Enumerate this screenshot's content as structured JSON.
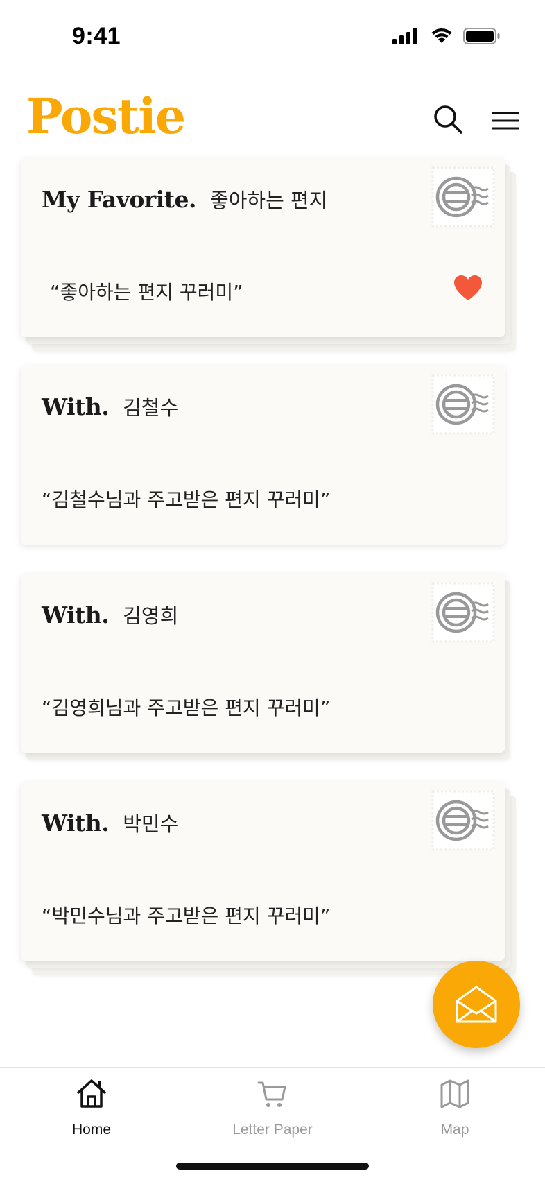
{
  "status_bar": {
    "time": "9:41",
    "icons": [
      "signal-icon",
      "wifi-icon",
      "battery-icon"
    ]
  },
  "header": {
    "logo": "Postie",
    "logo_color": "#F9A806",
    "icons": [
      "search-icon",
      "hamburger-menu-icon"
    ]
  },
  "cards": [
    {
      "kind": "My Favorite.",
      "name": "좋아하는 편지",
      "quote": "“좋아하는 편지 꾸러미”",
      "favorite": true
    },
    {
      "kind": "With.",
      "name": "김철수",
      "quote": "“김철수님과 주고받은 편지 꾸러미”",
      "favorite": false
    },
    {
      "kind": "With.",
      "name": "김영희",
      "quote": "“김영희님과 주고받은 편지 꾸러미”",
      "favorite": false
    },
    {
      "kind": "With.",
      "name": "박민수",
      "quote": "“박민수님과 주고받은 편지 꾸러미”",
      "favorite": false
    }
  ],
  "fab": {
    "icon": "open-envelope-icon",
    "color": "#F9A806"
  },
  "bottom_nav": [
    {
      "label": "Home",
      "icon": "home-icon",
      "active": true
    },
    {
      "label": "Letter Paper",
      "icon": "cart-icon",
      "active": false
    },
    {
      "label": "Map",
      "icon": "map-icon",
      "active": false
    }
  ],
  "colors": {
    "accent": "#F9A806",
    "heart": "#F4583A",
    "inactive": "#9a9a9a"
  }
}
